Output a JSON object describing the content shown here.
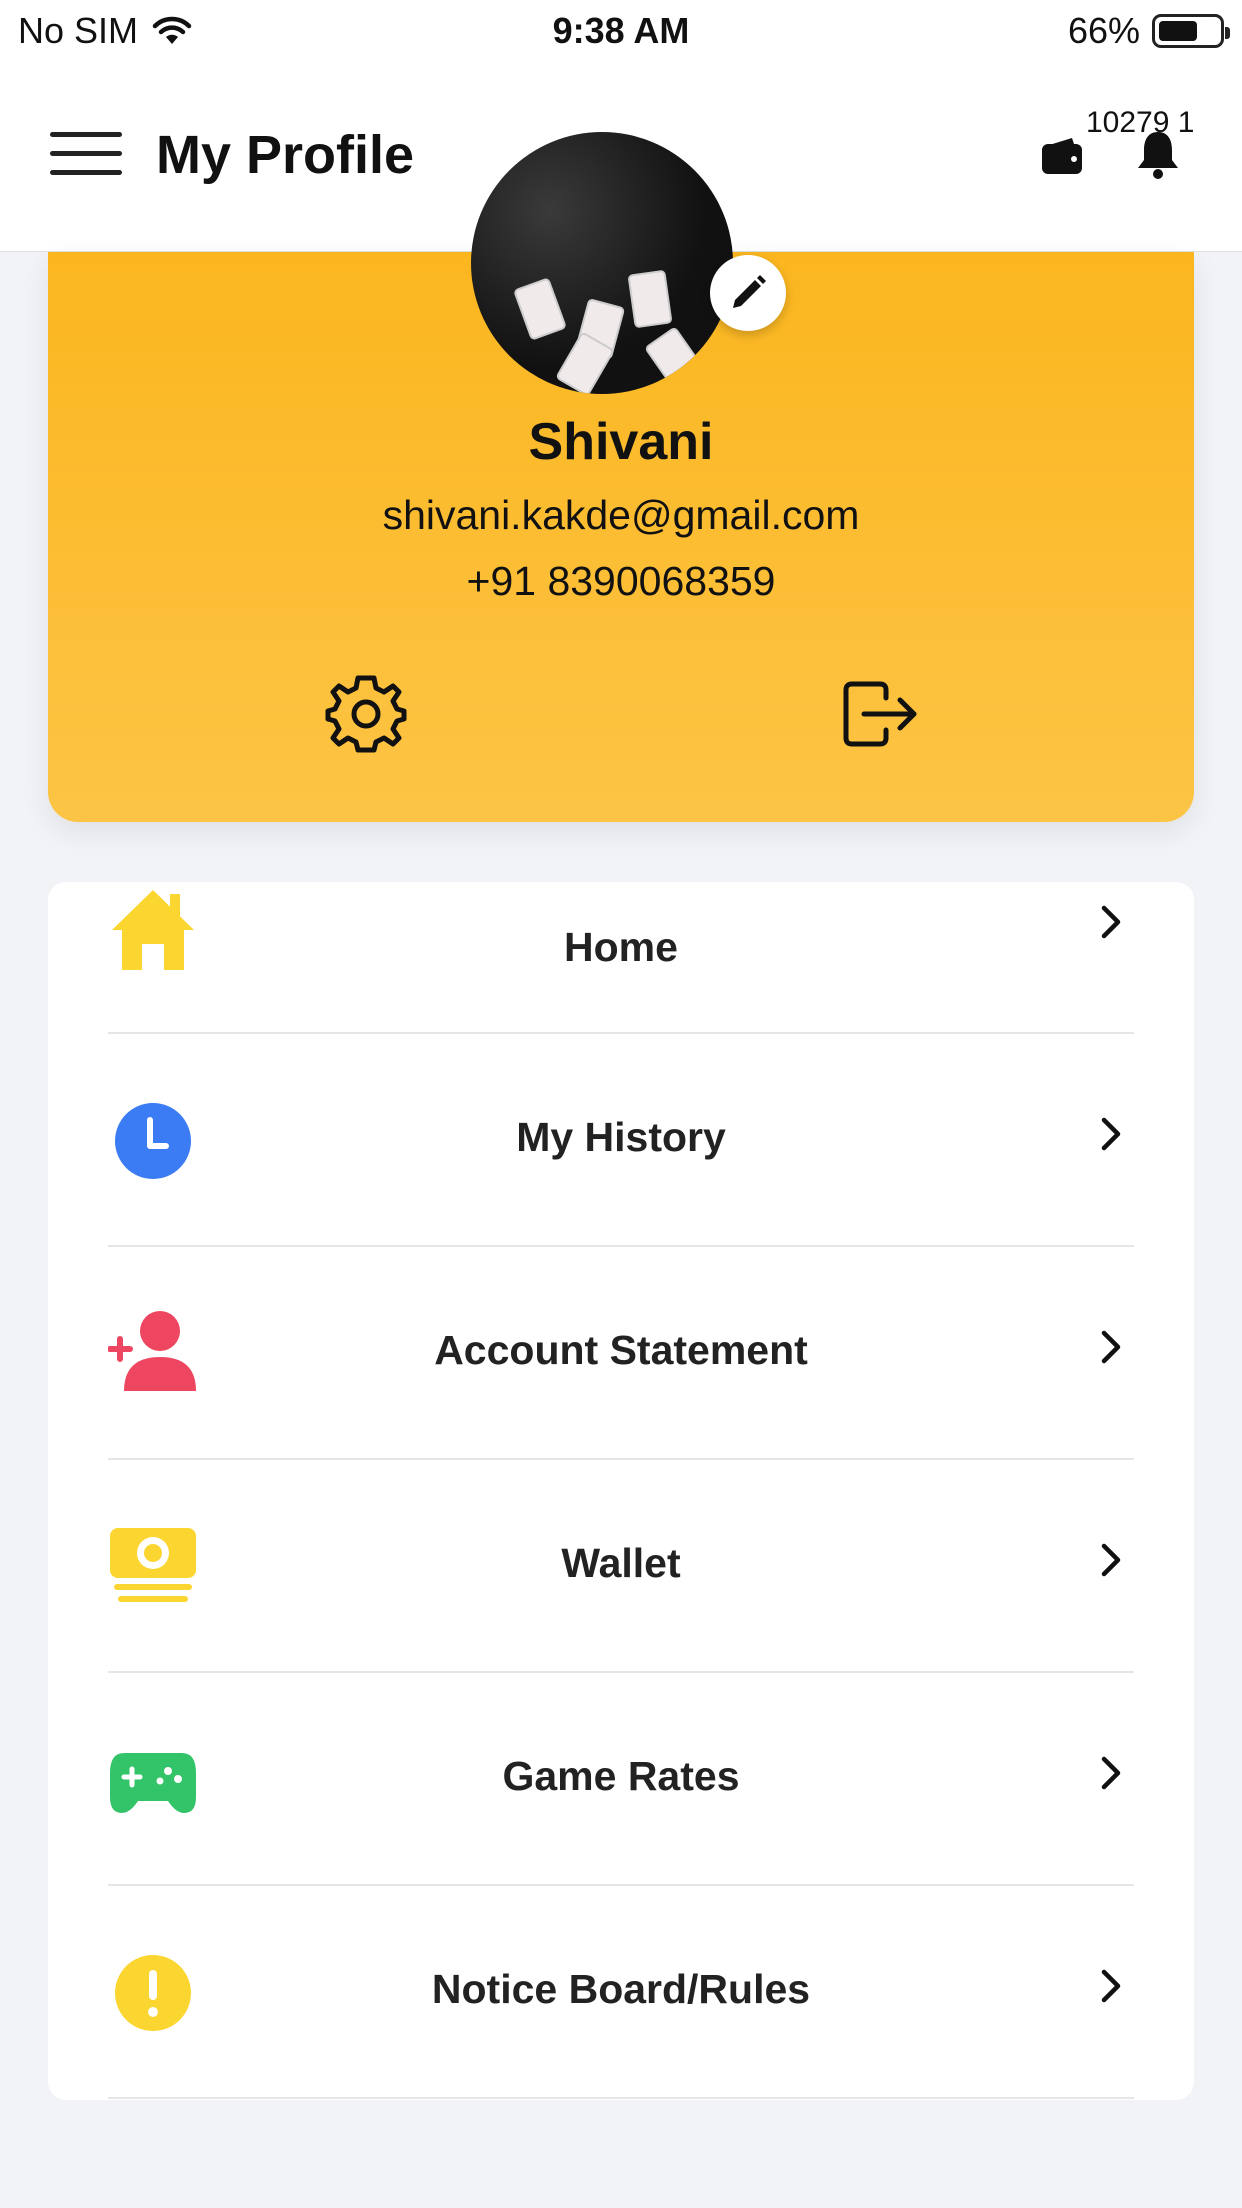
{
  "status_bar": {
    "carrier": "No SIM",
    "time": "9:38 AM",
    "battery": "66%",
    "battery_level": 0.66
  },
  "header": {
    "title": "My Profile",
    "counter_text": "10279 1",
    "icons": [
      "menu-icon",
      "wallet-icon",
      "bell-icon"
    ]
  },
  "profile": {
    "name": "Shivani",
    "email": "shivani.kakde@gmail.com",
    "phone": "+91 8390068359",
    "actions": [
      "settings-icon",
      "logout-icon"
    ]
  },
  "menu": {
    "items": [
      {
        "label": "Home",
        "icon": "home-icon",
        "color": "#fbd631"
      },
      {
        "label": "My History",
        "icon": "clock-icon",
        "color": "#3b7cf5"
      },
      {
        "label": "Account Statement",
        "icon": "add-user-icon",
        "color": "#ee4560"
      },
      {
        "label": "Wallet",
        "icon": "money-icon",
        "color": "#fbd631"
      },
      {
        "label": "Game Rates",
        "icon": "gamepad-icon",
        "color": "#33c46a"
      },
      {
        "label": "Notice Board/Rules",
        "icon": "alert-icon",
        "color": "#fbd631"
      }
    ]
  },
  "colors": {
    "accent": "#fbb61f",
    "background": "#f2f3f7"
  }
}
